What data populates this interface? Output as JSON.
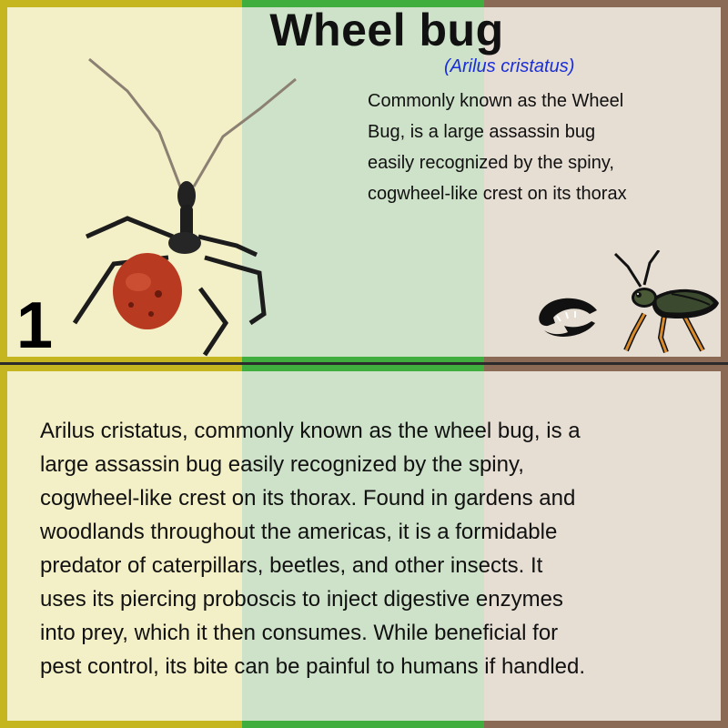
{
  "card": {
    "title": "Wheel bug",
    "scientific_name": "(Arilus cristatus)",
    "short_description": "Commonly known as the Wheel\n Bug, is a large assassin bug\n easily recognized by the spiny,\n cogwheel-like crest on its thorax",
    "number": "1",
    "long_description": "Arilus cristatus, commonly known as the wheel bug, is a\nlarge assassin bug easily recognized by the spiny,\ncogwheel-like crest on its thorax. Found in gardens and\nwoodlands throughout the americas, it is a formidable\npredator of caterpillars, beetles, and other insects. It\nuses its piercing proboscis to inject digestive enzymes\ninto prey, which it then consumes. While beneficial for\npest control, its bite can be painful to humans if handled."
  },
  "icons": {
    "photo": "wheel-bug-photo-icon",
    "predator": "claw-icon",
    "insect": "assassin-bug-icon"
  },
  "colors": {
    "band_yellow": "#f3efc6",
    "band_green": "#cde2c8",
    "band_brown": "#e6ddd3",
    "scientific_name": "#1a2ed8"
  }
}
